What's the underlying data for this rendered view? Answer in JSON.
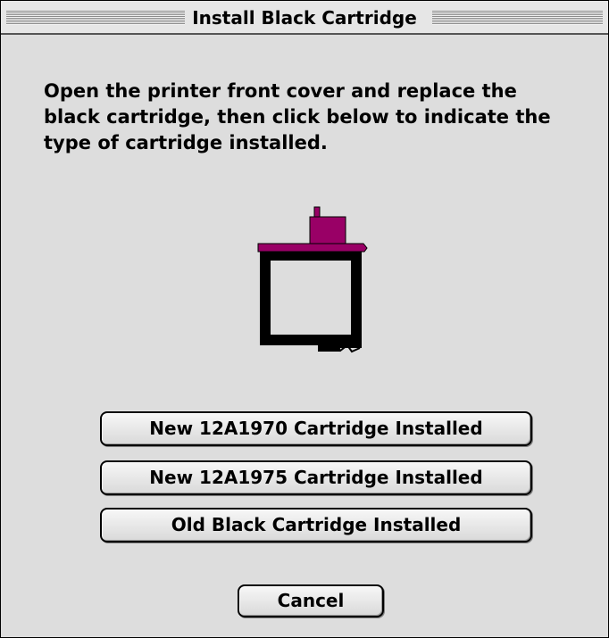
{
  "window": {
    "title": "Install Black Cartridge"
  },
  "message": "Open the printer front cover and replace the\nblack cartridge, then click below to indicate the\ntype of cartridge installed.",
  "icons": {
    "cartridge": "ink-cartridge-icon"
  },
  "colors": {
    "cartridge_top": "#990066",
    "cartridge_body": "#000000"
  },
  "buttons": {
    "option_1": "New 12A1970 Cartridge Installed",
    "option_2": "New 12A1975 Cartridge Installed",
    "option_3": "Old Black Cartridge Installed",
    "cancel": "Cancel"
  }
}
